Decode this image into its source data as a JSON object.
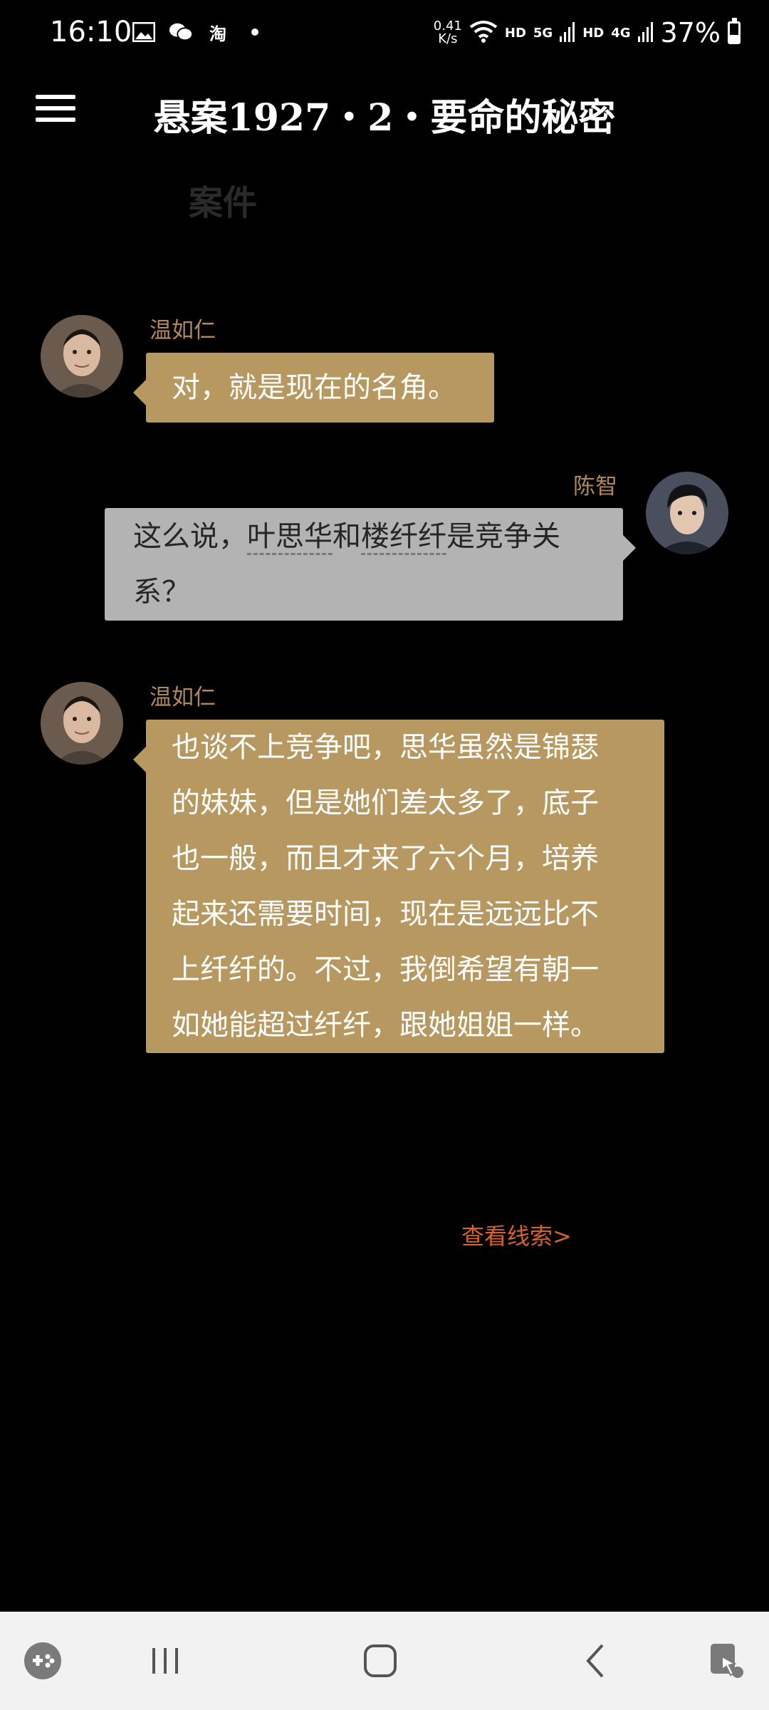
{
  "status_bar": {
    "time": "16:10",
    "speed_value": "0.41",
    "speed_unit": "K/s",
    "hd1": "HD",
    "net1": "5G",
    "hd2": "HD",
    "net2": "4G",
    "battery": "37%",
    "battery_level": 0.37,
    "icons": [
      "gallery-icon",
      "wechat-icon",
      "taobao-icon",
      "dot-icon",
      "wifi-icon",
      "signal-icon",
      "signal-icon",
      "battery-icon"
    ]
  },
  "header": {
    "title": "悬案1927・2・要命的秘密",
    "faded_label": "案件"
  },
  "messages": [
    {
      "sender": "温如仁",
      "side": "left",
      "lines": [
        "对，就是现在的名角。"
      ]
    },
    {
      "sender": "陈智",
      "side": "right",
      "line1_pre": "这么说，",
      "kw1": "叶思华",
      "mid": "和",
      "kw2": "楼纤纤",
      "line1_post": "是竞争关",
      "line2": "系？"
    },
    {
      "sender": "温如仁",
      "side": "left",
      "lines": [
        "也谈不上竞争吧，思华虽然是锦瑟",
        "的妹妹，但是她们差太多了，底子",
        "也一般，而且才来了六个月，培养",
        "起来还需要时间，现在是远远比不",
        "上纤纤的。不过，我倒希望有朝一",
        "如她能超过纤纤，跟她姐姐一样。"
      ]
    }
  ],
  "clue_link": "查看线索>",
  "colors": {
    "bubble_gold": "#b79860",
    "bubble_grey": "#b3b3b3",
    "link": "#d8632a",
    "name": "#b0895a"
  }
}
